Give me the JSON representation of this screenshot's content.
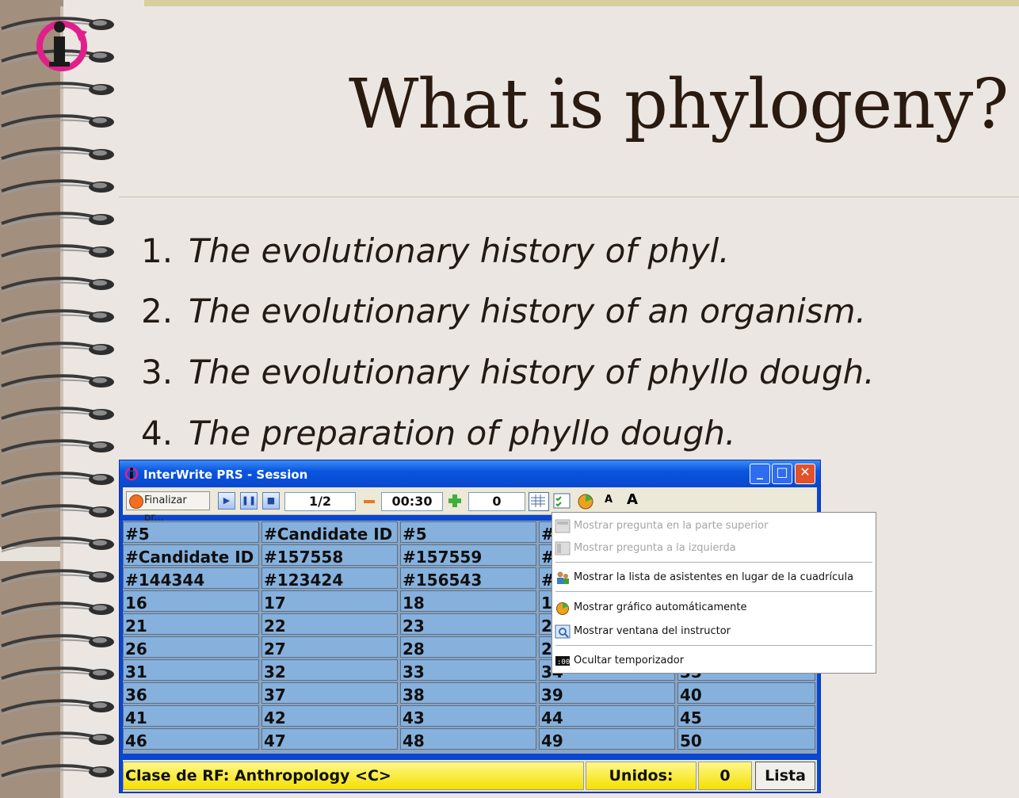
{
  "slide": {
    "title": "What is phylogeny?",
    "options": [
      {
        "num": "1.",
        "text": "The evolutionary history of phyl."
      },
      {
        "num": "2.",
        "text": "The evolutionary history of an organism."
      },
      {
        "num": "3.",
        "text": "The evolutionary history of phyllo dough."
      },
      {
        "num": "4.",
        "text": "The preparation of phyllo dough."
      }
    ]
  },
  "window": {
    "title": "InterWrite PRS - Session",
    "controls": {
      "minimize": "_",
      "maximize": "□",
      "close": "✕"
    }
  },
  "toolbar": {
    "end_label": "Finalizar pr...",
    "question_counter": "1/2",
    "timer": "00:30",
    "count": "0",
    "play_icon": "play-icon",
    "pause_icon": "pause-icon",
    "stop_icon": "stop-icon"
  },
  "grid": {
    "rows": [
      [
        "#5",
        "#Candidate ID",
        "#5",
        "#",
        ""
      ],
      [
        "#Candidate ID",
        "#157558",
        "#157559",
        "#",
        ""
      ],
      [
        "#144344",
        "#123424",
        "#156543",
        "#",
        ""
      ],
      [
        "16",
        "17",
        "18",
        "1",
        ""
      ],
      [
        "21",
        "22",
        "23",
        "2",
        ""
      ],
      [
        "26",
        "27",
        "28",
        "2",
        ""
      ],
      [
        "31",
        "32",
        "33",
        "34",
        "35"
      ],
      [
        "36",
        "37",
        "38",
        "39",
        "40"
      ],
      [
        "41",
        "42",
        "43",
        "44",
        "45"
      ],
      [
        "46",
        "47",
        "48",
        "49",
        "50"
      ]
    ]
  },
  "status": {
    "class_label": "Clase de RF: Anthropology <C>",
    "joined_label": "Unidos:",
    "joined_count": "0",
    "list_button": "Lista"
  },
  "menu": {
    "items": [
      {
        "label": "Mostrar pregunta en la parte superior",
        "enabled": false
      },
      {
        "label": "Mostrar pregunta a la izquierda",
        "enabled": false
      },
      {
        "label": "Mostrar la lista de asistentes en lugar de la cuadrícula",
        "enabled": true
      },
      {
        "label": "Mostrar gráfico automáticamente",
        "enabled": true
      },
      {
        "label": "Mostrar ventana del instructor",
        "enabled": true
      },
      {
        "label": "Ocultar temporizador",
        "enabled": true
      }
    ]
  },
  "colors": {
    "titlebar": "#0a55e0",
    "grid_cell": "#86b1dd",
    "status_yellow": "#f4e000",
    "logo_magenta": "#e0208a"
  }
}
